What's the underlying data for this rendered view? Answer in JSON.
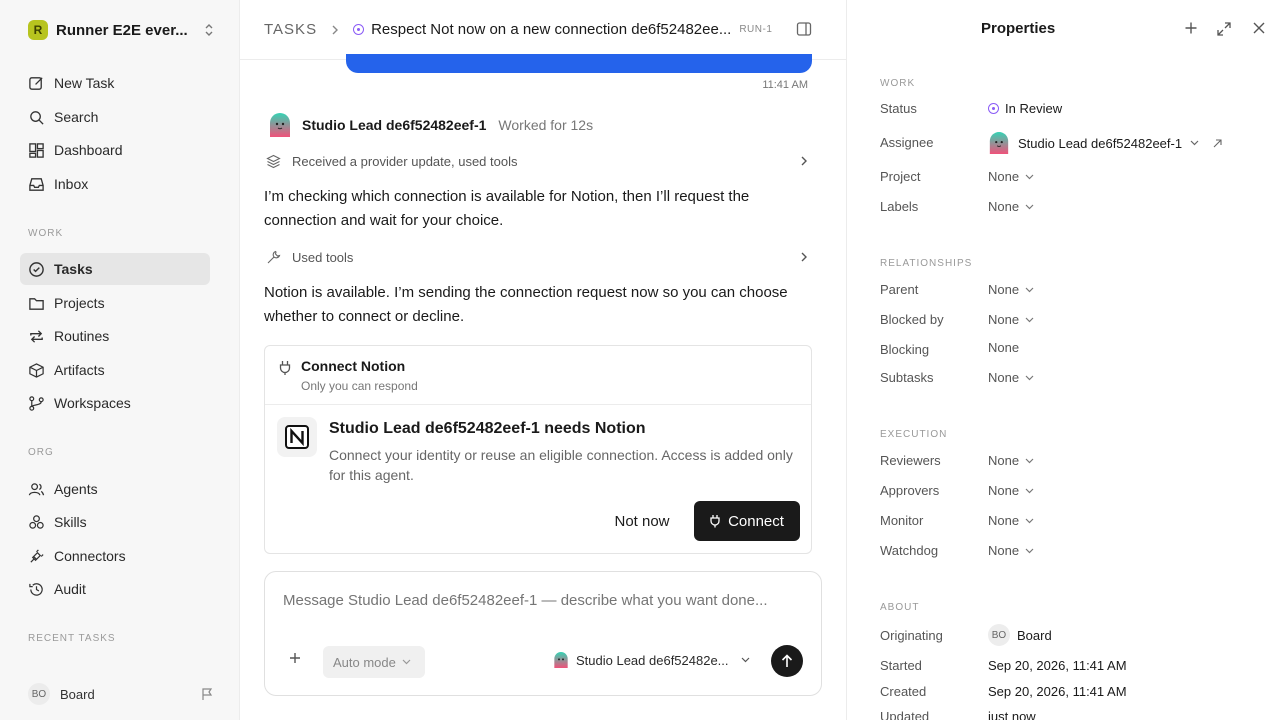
{
  "workspace": {
    "name": "Runner E2E ever...",
    "logo_letter": "R"
  },
  "nav": {
    "top": [
      {
        "label": "New Task",
        "icon": "edit-icon"
      },
      {
        "label": "Search",
        "icon": "search-icon"
      },
      {
        "label": "Dashboard",
        "icon": "dashboard-icon"
      },
      {
        "label": "Inbox",
        "icon": "inbox-icon"
      }
    ],
    "work_label": "WORK",
    "work": [
      {
        "label": "Tasks",
        "icon": "check-circle-icon",
        "active": true
      },
      {
        "label": "Projects",
        "icon": "folder-icon"
      },
      {
        "label": "Routines",
        "icon": "repeat-icon"
      },
      {
        "label": "Artifacts",
        "icon": "box-icon"
      },
      {
        "label": "Workspaces",
        "icon": "branch-icon"
      }
    ],
    "org_label": "ORG",
    "org": [
      {
        "label": "Agents",
        "icon": "users-icon"
      },
      {
        "label": "Skills",
        "icon": "skills-icon"
      },
      {
        "label": "Connectors",
        "icon": "plug-icon"
      },
      {
        "label": "Audit",
        "icon": "history-icon"
      }
    ],
    "recent_label": "RECENT TASKS",
    "board": {
      "initials": "BO",
      "name": "Board"
    }
  },
  "header": {
    "root": "TASKS",
    "title": "Respect Not now on a new connection de6f52482ee...",
    "run": "RUN-1"
  },
  "thread": {
    "time": "11:41 AM",
    "agent_name": "Studio Lead de6f52482eef-1",
    "worked": "Worked for 12s",
    "tool1": "Received a provider update, used tools",
    "msg1": "I’m checking which connection is available for Notion, then I’ll request the connection and wait for your choice.",
    "tool2": "Used tools",
    "msg2": "Notion is available. I’m sending the connection request now so you can choose whether to connect or decline."
  },
  "card": {
    "title": "Connect Notion",
    "subtitle": "Only you can respond",
    "heading": "Studio Lead de6f52482eef-1 needs Notion",
    "desc": "Connect your identity or reuse an eligible connection. Access is added only for this agent.",
    "not_now": "Not now",
    "connect": "Connect"
  },
  "composer": {
    "placeholder": "Message Studio Lead de6f52482eef-1 — describe what you want done...",
    "mode": "Auto mode",
    "agent": "Studio Lead de6f52482e..."
  },
  "props": {
    "title": "Properties",
    "work_label": "WORK",
    "status_label": "Status",
    "status": "In Review",
    "assignee_label": "Assignee",
    "assignee": "Studio Lead de6f52482eef-1",
    "project_label": "Project",
    "project": "None",
    "labels_label": "Labels",
    "labels": "None",
    "rel_label": "RELATIONSHIPS",
    "parent_label": "Parent",
    "parent": "None",
    "blocked_label": "Blocked by",
    "blocked": "None",
    "blocking_label": "Blocking",
    "blocking": "None",
    "subtasks_label": "Subtasks",
    "subtasks": "None",
    "exec_label": "EXECUTION",
    "reviewers_label": "Reviewers",
    "reviewers": "None",
    "approvers_label": "Approvers",
    "approvers": "None",
    "monitor_label": "Monitor",
    "monitor": "None",
    "watchdog_label": "Watchdog",
    "watchdog": "None",
    "about_label": "ABOUT",
    "orig_label": "Originating",
    "orig_initials": "BO",
    "orig": "Board",
    "started_label": "Started",
    "started": "Sep 20, 2026, 11:41 AM",
    "created_label": "Created",
    "created": "Sep 20, 2026, 11:41 AM",
    "updated_label": "Updated",
    "updated": "just now"
  },
  "colors": {
    "accent": "#2563eb",
    "status": "#8b5cf6",
    "dark": "#1a1a1a"
  }
}
